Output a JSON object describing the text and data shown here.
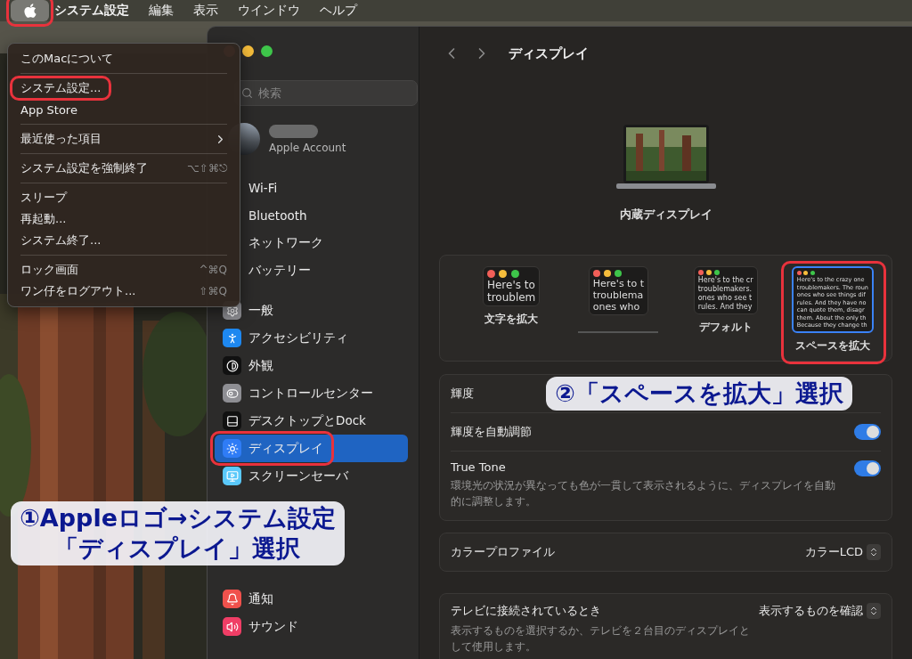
{
  "menu_bar": {
    "apple": {
      "selected": true,
      "highlighted": true
    },
    "items": [
      {
        "label": "システム設定",
        "kind": "app"
      },
      {
        "label": "編集",
        "kind": "menu"
      },
      {
        "label": "表示",
        "kind": "menu"
      },
      {
        "label": "ウインドウ",
        "kind": "menu"
      },
      {
        "label": "ヘルプ",
        "kind": "menu"
      }
    ]
  },
  "apple_menu": {
    "groups": [
      [
        {
          "label": "このMacについて",
          "highlighted": false
        }
      ],
      [
        {
          "label": "システム設定...",
          "highlighted": true
        },
        {
          "label": "App Store",
          "highlighted": false
        }
      ],
      [
        {
          "label": "最近使った項目",
          "submenu": true,
          "highlighted": false
        }
      ],
      [
        {
          "label": "システム設定を強制終了",
          "shortcut": "⌥⇧⌘⎋",
          "highlighted": false
        }
      ],
      [
        {
          "label": "スリープ",
          "highlighted": false
        },
        {
          "label": "再起動...",
          "highlighted": false
        },
        {
          "label": "システム終了...",
          "highlighted": false
        }
      ],
      [
        {
          "label": "ロック画面",
          "shortcut": "^⌘Q",
          "highlighted": false
        },
        {
          "label": "ワン仔をログアウト...",
          "shortcut": "⇧⌘Q",
          "highlighted": false
        }
      ]
    ]
  },
  "sidebar": {
    "search": {
      "placeholder": "検索"
    },
    "account": {
      "subtitle": "Apple Account"
    },
    "groups": [
      {
        "items": [
          {
            "label": "Wi-Fi",
            "selected": false,
            "highlighted": false
          },
          {
            "label": "Bluetooth",
            "selected": false,
            "highlighted": false
          },
          {
            "label": "ネットワーク",
            "selected": false,
            "highlighted": false
          },
          {
            "label": "バッテリー",
            "selected": false,
            "highlighted": false
          }
        ]
      },
      {
        "items": [
          {
            "label": "一般",
            "color": "#8e8e93",
            "selected": false,
            "highlighted": false
          },
          {
            "label": "アクセシビリティ",
            "color": "#1e88f0",
            "selected": false,
            "highlighted": false
          },
          {
            "label": "外観",
            "color": "#111111",
            "selected": false,
            "highlighted": false
          },
          {
            "label": "コントロールセンター",
            "color": "#8e8e93",
            "selected": false,
            "highlighted": false
          },
          {
            "label": "デスクトップとDock",
            "color": "#111111",
            "selected": false,
            "highlighted": false
          },
          {
            "label": "ディスプレイ",
            "color": "#2f7cf6",
            "selected": true,
            "highlighted": true
          },
          {
            "label": "スクリーンセーバ",
            "color": "#5ac8fa",
            "selected": false,
            "highlighted": false
          }
        ]
      },
      {
        "items": [
          {
            "label": "通知",
            "color": "#f0514c",
            "selected": false,
            "highlighted": false
          },
          {
            "label": "サウンド",
            "color": "#f03e66",
            "selected": false,
            "highlighted": false
          }
        ]
      }
    ]
  },
  "content": {
    "title": "ディスプレイ",
    "display_name": "内蔵ディスプレイ",
    "options": [
      {
        "label": "文字を拡大",
        "kind": "large",
        "selected": false,
        "highlighted": false,
        "lines": [
          "Here's to",
          "troublem"
        ]
      },
      {
        "kind": "medium",
        "selected": false,
        "highlighted": false,
        "lines": [
          "Here's to t",
          "troublema",
          "ones who"
        ]
      },
      {
        "label": "デフォルト",
        "kind": "default",
        "selected": false,
        "highlighted": false,
        "lines": [
          "Here's to the cr",
          "troublemakers.",
          "ones who see t",
          "rules. And they"
        ]
      },
      {
        "label": "スペースを拡大",
        "kind": "small",
        "selected": true,
        "highlighted": true,
        "lines": [
          "Here's to the crazy one",
          "troublemakers. The roun",
          "ones who see things dif",
          "rules. And they have no",
          "can quote them, disagr",
          "them. About the only th",
          "Because they change th"
        ]
      }
    ],
    "groups": [
      [
        {
          "kind": "label",
          "label": "輝度"
        },
        {
          "kind": "toggle",
          "label": "輝度を自動調節",
          "on": true
        },
        {
          "kind": "toggle",
          "label": "True Tone",
          "description": "環境光の状況が異なっても色が一貫して表示されるように、ディスプレイを自動的に調整します。",
          "on": true
        }
      ],
      [
        {
          "kind": "popup",
          "label": "カラープロファイル",
          "value": "カラーLCD"
        }
      ],
      [
        {
          "kind": "popup",
          "label": "テレビに接続されているとき",
          "description": "表示するものを選択するか、テレビを２台目のディスプレイとして使用します。",
          "value": "表示するものを確認"
        }
      ]
    ]
  },
  "annotations": [
    {
      "lines": [
        "①Appleロゴ→システム設定",
        "「ディスプレイ」選択"
      ]
    },
    {
      "lines": [
        "②「スペースを拡大」選択"
      ]
    }
  ]
}
